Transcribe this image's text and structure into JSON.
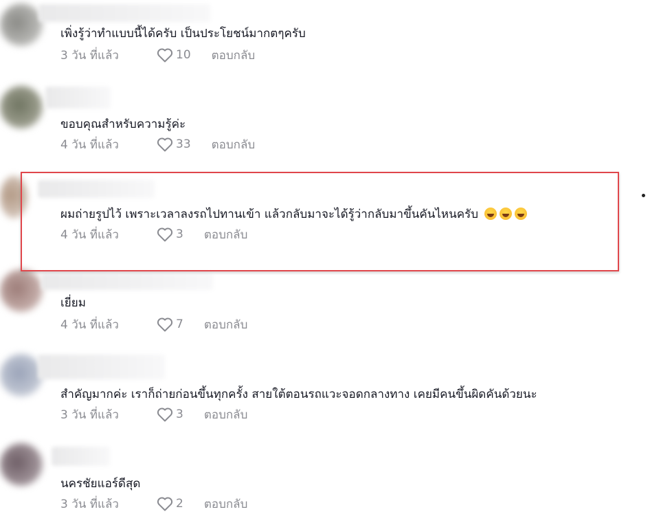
{
  "comments": [
    {
      "text": "เพิ่งรู้ว่าทำแบบนี้ได้ครับ เป็นประโยชน์มากตๆครับ",
      "time": "3 วัน ที่แล้ว",
      "likes": "10",
      "reply_label": "ตอบกลับ"
    },
    {
      "text": "ขอบคุณสำหรับความรู้ค่ะ",
      "time": "4 วัน ที่แล้ว",
      "likes": "33",
      "reply_label": "ตอบกลับ"
    },
    {
      "text": "ผมถ่ายรูปไว้ เพราะเวลาลงรถไปทานเข้า แล้วกลับมาจะได้รู้ว่ากลับมาขึ้นคันไหนครับ",
      "emoji_name": "laughing-emoji",
      "time": "4 วัน ที่แล้ว",
      "likes": "3",
      "reply_label": "ตอบกลับ"
    },
    {
      "text": "เยี่ยม",
      "time": "4 วัน ที่แล้ว",
      "likes": "7",
      "reply_label": "ตอบกลับ"
    },
    {
      "text": "สำคัญมากค่ะ เราก็ถ่ายก่อนขึ้นทุกครั้ง สายใต้ตอนรถแวะจอดกลางทาง เคยมีคนขึ้นผิดคันด้วยนะ",
      "time": "3 วัน ที่แล้ว",
      "likes": "3",
      "reply_label": "ตอบกลับ"
    },
    {
      "text": "นครชัยแอร์ดีสุด",
      "time": "3 วัน ที่แล้ว",
      "likes": "2",
      "reply_label": "ตอบกลับ"
    }
  ],
  "colors": {
    "highlight_border": "#e0464b",
    "meta_text": "#8a8b91",
    "comment_text": "#161823"
  },
  "icons": {
    "like": "heart-outline-icon",
    "more": "more-dot-icon"
  }
}
